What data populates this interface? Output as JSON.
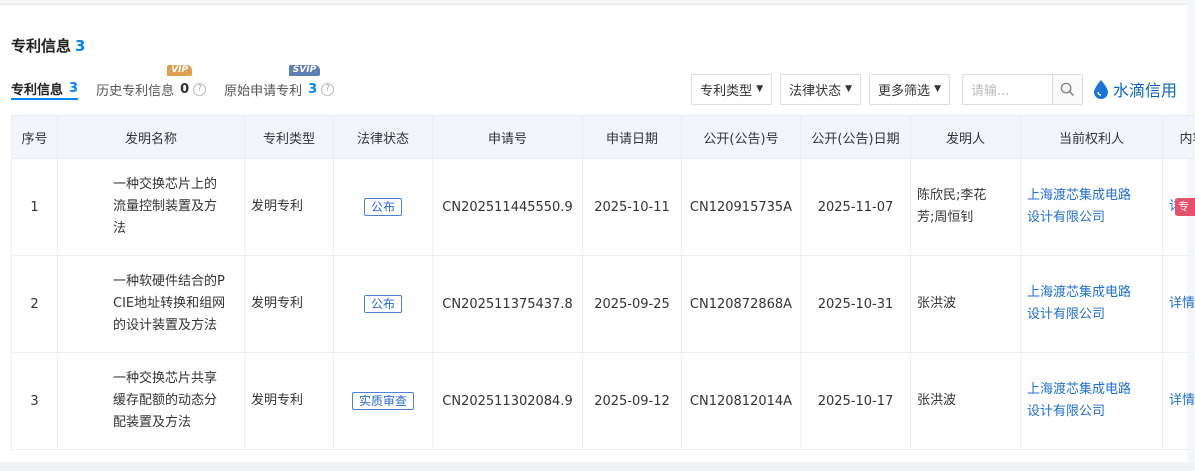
{
  "section": {
    "title": "专利信息",
    "count": "3"
  },
  "tabs": [
    {
      "label": "专利信息",
      "count": "3"
    },
    {
      "label": "历史专利信息",
      "count": "0",
      "badge": "VIP"
    },
    {
      "label": "原始申请专利",
      "count": "3",
      "badge": "SVIP"
    }
  ],
  "filters": {
    "type": "专利类型",
    "status": "法律状态",
    "more": "更多筛选"
  },
  "search": {
    "placeholder": "请输..."
  },
  "brand": {
    "name": "水滴信用"
  },
  "table": {
    "headers": [
      "序号",
      "发明名称",
      "专利类型",
      "法律状态",
      "申请号",
      "申请日期",
      "公开(公告)号",
      "公开(公告)日期",
      "发明人",
      "当前权利人",
      "内容"
    ],
    "rows": [
      {
        "no": "1",
        "name": [
          "一种交换芯片上的",
          "流量控制装置及方",
          "法"
        ],
        "type": "发明专利",
        "status": "公布",
        "app_no": "CN202511445550.9",
        "app_date": "2025-10-11",
        "pub_no": "CN120915735A",
        "pub_date": "2025-11-07",
        "inventor": [
          "陈欣民;李花",
          "芳;周恒钊"
        ],
        "owner": [
          "上海渡芯集成电路",
          "设计有限公司"
        ],
        "detail": "详情"
      },
      {
        "no": "2",
        "name": [
          "一种软硬件结合的P",
          "CIE地址转换和组网",
          "的设计装置及方法"
        ],
        "type": "发明专利",
        "status": "公布",
        "app_no": "CN202511375437.8",
        "app_date": "2025-09-25",
        "pub_no": "CN120872868A",
        "pub_date": "2025-10-31",
        "inventor": [
          "张洪波"
        ],
        "owner": [
          "上海渡芯集成电路",
          "设计有限公司"
        ],
        "detail": "详情"
      },
      {
        "no": "3",
        "name": [
          "一种交换芯片共享",
          "缓存配额的动态分",
          "配装置及方法"
        ],
        "type": "发明专利",
        "status": "实质审查",
        "app_no": "CN202511302084.9",
        "app_date": "2025-09-12",
        "pub_no": "CN120812014A",
        "pub_date": "2025-10-17",
        "inventor": [
          "张洪波"
        ],
        "owner": [
          "上海渡芯集成电路",
          "设计有限公司"
        ],
        "detail": "详情"
      }
    ]
  },
  "side_tag": "专利",
  "colors": {
    "accent": "#0084ff",
    "link": "#1f6fd6",
    "header_bg": "#f2f6fc",
    "side_tag": "#e5506b"
  }
}
